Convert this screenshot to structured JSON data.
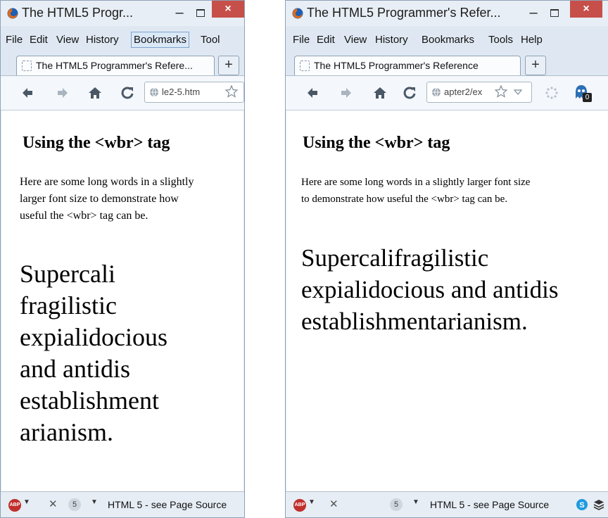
{
  "window_left": {
    "title": "The HTML5 Progr...",
    "menu": [
      "File",
      "Edit",
      "View",
      "History",
      "Bookmarks",
      "Tool"
    ],
    "tab_label": "The HTML5 Programmer's Refere...",
    "new_tab": "+",
    "url": "le2-5.htm",
    "page": {
      "heading": "Using the <wbr> tag",
      "paragraph_lines": [
        "Here are some long words in a slightly",
        "larger font size to demonstrate how",
        "useful the <wbr> tag can be."
      ],
      "long_text_lines": [
        "Supercali",
        "fragilistic",
        "expialidocious",
        "and antidis",
        "establishment",
        "arianism."
      ]
    },
    "status": {
      "count": "5",
      "text": "HTML 5 - see Page Source"
    }
  },
  "window_right": {
    "title": "The HTML5 Programmer's Refer...",
    "menu": [
      "File",
      "Edit",
      "View",
      "History",
      "Bookmarks",
      "Tools",
      "Help"
    ],
    "tab_label": "The HTML5 Programmer's Reference",
    "new_tab": "+",
    "url": "apter2/ex",
    "addon_badge": "0",
    "page": {
      "heading": "Using the <wbr> tag",
      "paragraph_lines": [
        "Here are some long words in a slightly larger font size",
        "to demonstrate how useful the <wbr> tag can be."
      ],
      "long_text_lines": [
        "Supercalifragilistic",
        "expialidocious and antidis",
        "establishmentarianism."
      ]
    },
    "status": {
      "count": "5",
      "text": "HTML 5 - see Page Source"
    }
  },
  "window_buttons": {
    "minimize": "–",
    "close": "×"
  },
  "colors": {
    "close_button": "#c74f4a",
    "chrome": "#dfe8f2",
    "menu_highlight": "#dbe8f6",
    "abp": "#c0302c"
  },
  "icons": [
    "firefox-icon",
    "back-arrow-icon",
    "forward-arrow-icon",
    "home-icon",
    "reload-icon",
    "globe-icon",
    "star-icon",
    "bookmark-dropdown-icon",
    "loading-spinner-icon",
    "ghostery-icon",
    "adblock-plus-icon",
    "skype-icon",
    "buffer-icon"
  ]
}
